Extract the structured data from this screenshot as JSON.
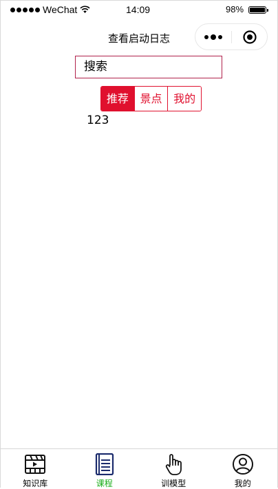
{
  "status_bar": {
    "carrier": "WeChat",
    "time": "14:09",
    "battery": "98%",
    "battery_level": 0.98
  },
  "nav": {
    "title": "查看启动日志",
    "menu_icon": "more-dots-icon",
    "close_icon": "target-circle-icon"
  },
  "search": {
    "text": "搜索"
  },
  "tabs": [
    {
      "label": "推荐",
      "active": true
    },
    {
      "label": "景点",
      "active": false
    },
    {
      "label": "我的",
      "active": false
    }
  ],
  "content": {
    "text": "123"
  },
  "tabbar": {
    "items": [
      {
        "label": "知识库",
        "icon": "film-clapper-icon",
        "selected": false
      },
      {
        "label": "课程",
        "icon": "book-icon",
        "selected": true
      },
      {
        "label": "训模型",
        "icon": "hand-pointer-icon",
        "selected": false
      },
      {
        "label": "我的",
        "icon": "user-circle-icon",
        "selected": false
      }
    ],
    "selected_color": "#1aad19",
    "accent_color": "#e0102e"
  }
}
